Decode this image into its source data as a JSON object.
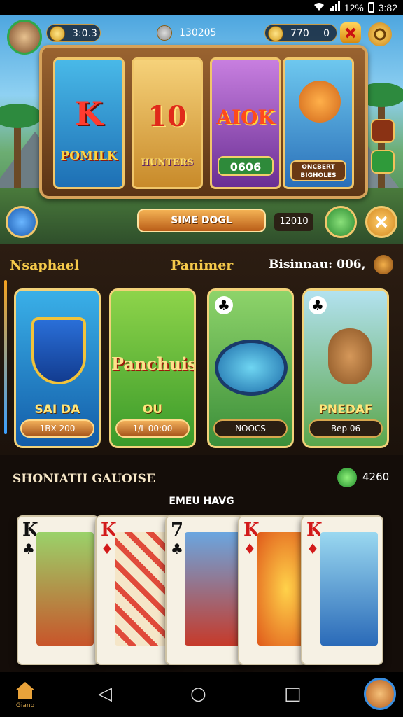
{
  "status_bar": {
    "battery": "12%",
    "time": "3:82"
  },
  "hud": {
    "left_value": "3:0.3",
    "center_value": "130205",
    "coins": "770",
    "coin_extra": "0"
  },
  "slots": [
    {
      "big": "K",
      "label": "POMILK"
    },
    {
      "big": "10",
      "label": "HUNTERS"
    },
    {
      "big": "AIOK",
      "badge": "0606"
    },
    {
      "label": "ONCBERT BIGHOLES"
    }
  ],
  "scene_bar": {
    "button_label": "SIME DOGL",
    "value": "12010"
  },
  "middle": {
    "label_left": "Nsaphael",
    "label_center": "Panimer",
    "label_right": "Bisinnau: 006,",
    "cards": [
      {
        "caption": "SAI DA",
        "button": "1BX 200"
      },
      {
        "title": "Panchuis",
        "caption": "OU",
        "button": "1/L 00:00"
      },
      {
        "button": "NOOCS"
      },
      {
        "caption": "PNEDAF",
        "button": "Bep 06"
      }
    ]
  },
  "lower": {
    "title": "SHONIATII GAUOISE",
    "value": "4260",
    "subtitle": "EMEU HAVG",
    "cards": [
      {
        "rank": "K",
        "suit": "♣"
      },
      {
        "rank": "K",
        "suit": "♦"
      },
      {
        "rank": "7",
        "suit": "♣"
      },
      {
        "rank": "K",
        "suit": "♦"
      },
      {
        "rank": "K",
        "suit": "♦"
      }
    ]
  },
  "nav": {
    "home_label": "Giano",
    "back": "◁",
    "home": "○",
    "recents": "□"
  }
}
